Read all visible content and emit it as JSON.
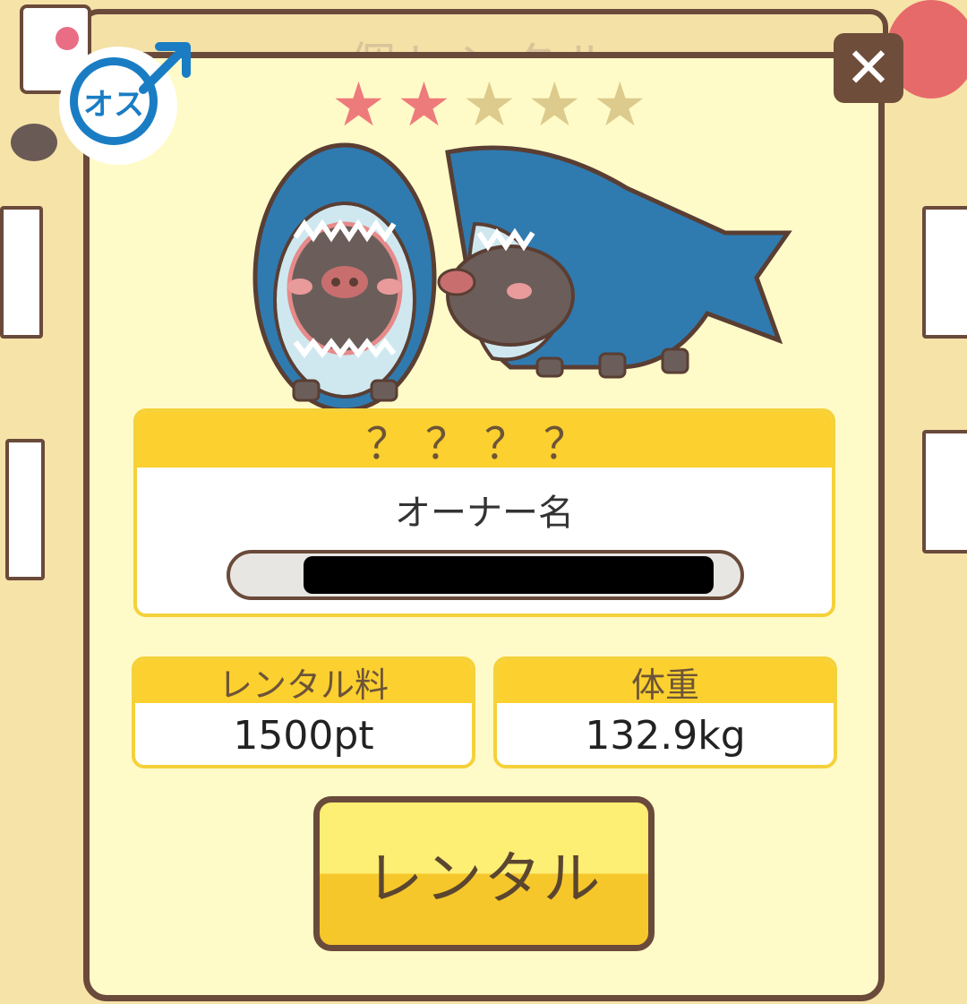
{
  "background": {
    "title_text": "個レンタル"
  },
  "modal": {
    "close_icon": "close-icon",
    "gender": {
      "label": "オス",
      "icon": "male-symbol-icon",
      "color": "#1a7dc4"
    },
    "rating": {
      "value": 2,
      "max": 5,
      "filled_color": "#ee7b7b",
      "empty_color": "#dccb8d"
    },
    "pet_name": "？？？？",
    "owner_label": "オーナー名",
    "stats": {
      "rental_fee_label": "レンタル料",
      "rental_fee_value": "1500pt",
      "weight_label": "体重",
      "weight_value": "132.9kg"
    },
    "rent_button_label": "レンタル"
  },
  "colors": {
    "border_brown": "#6a4a3a",
    "panel_yellow": "#fbd02f",
    "modal_bg": "#fffbc8"
  }
}
